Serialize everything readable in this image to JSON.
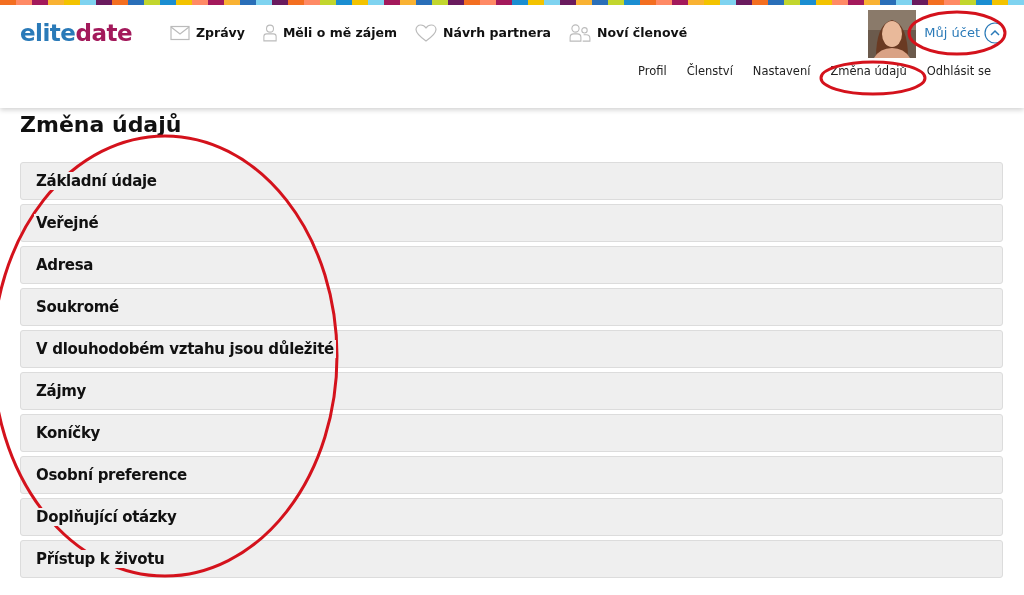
{
  "logo": {
    "first": "elite",
    "second": "date"
  },
  "nav": [
    "Zprávy",
    "Měli o mě zájem",
    "Návrh partnera",
    "Noví členové"
  ],
  "account": {
    "label": "Můj účet",
    "expanded": true
  },
  "account_menu": [
    "Profil",
    "Členství",
    "Nastavení",
    "Změna údajů",
    "Odhlásit se"
  ],
  "heading": "Změna údajů",
  "sections": [
    "Základní údaje",
    "Veřejné",
    "Adresa",
    "Soukromé",
    "V dlouhodobém vztahu jsou důležité",
    "Zájmy",
    "Koníčky",
    "Osobní preference",
    "Doplňující otázky",
    "Přístup k životu"
  ]
}
